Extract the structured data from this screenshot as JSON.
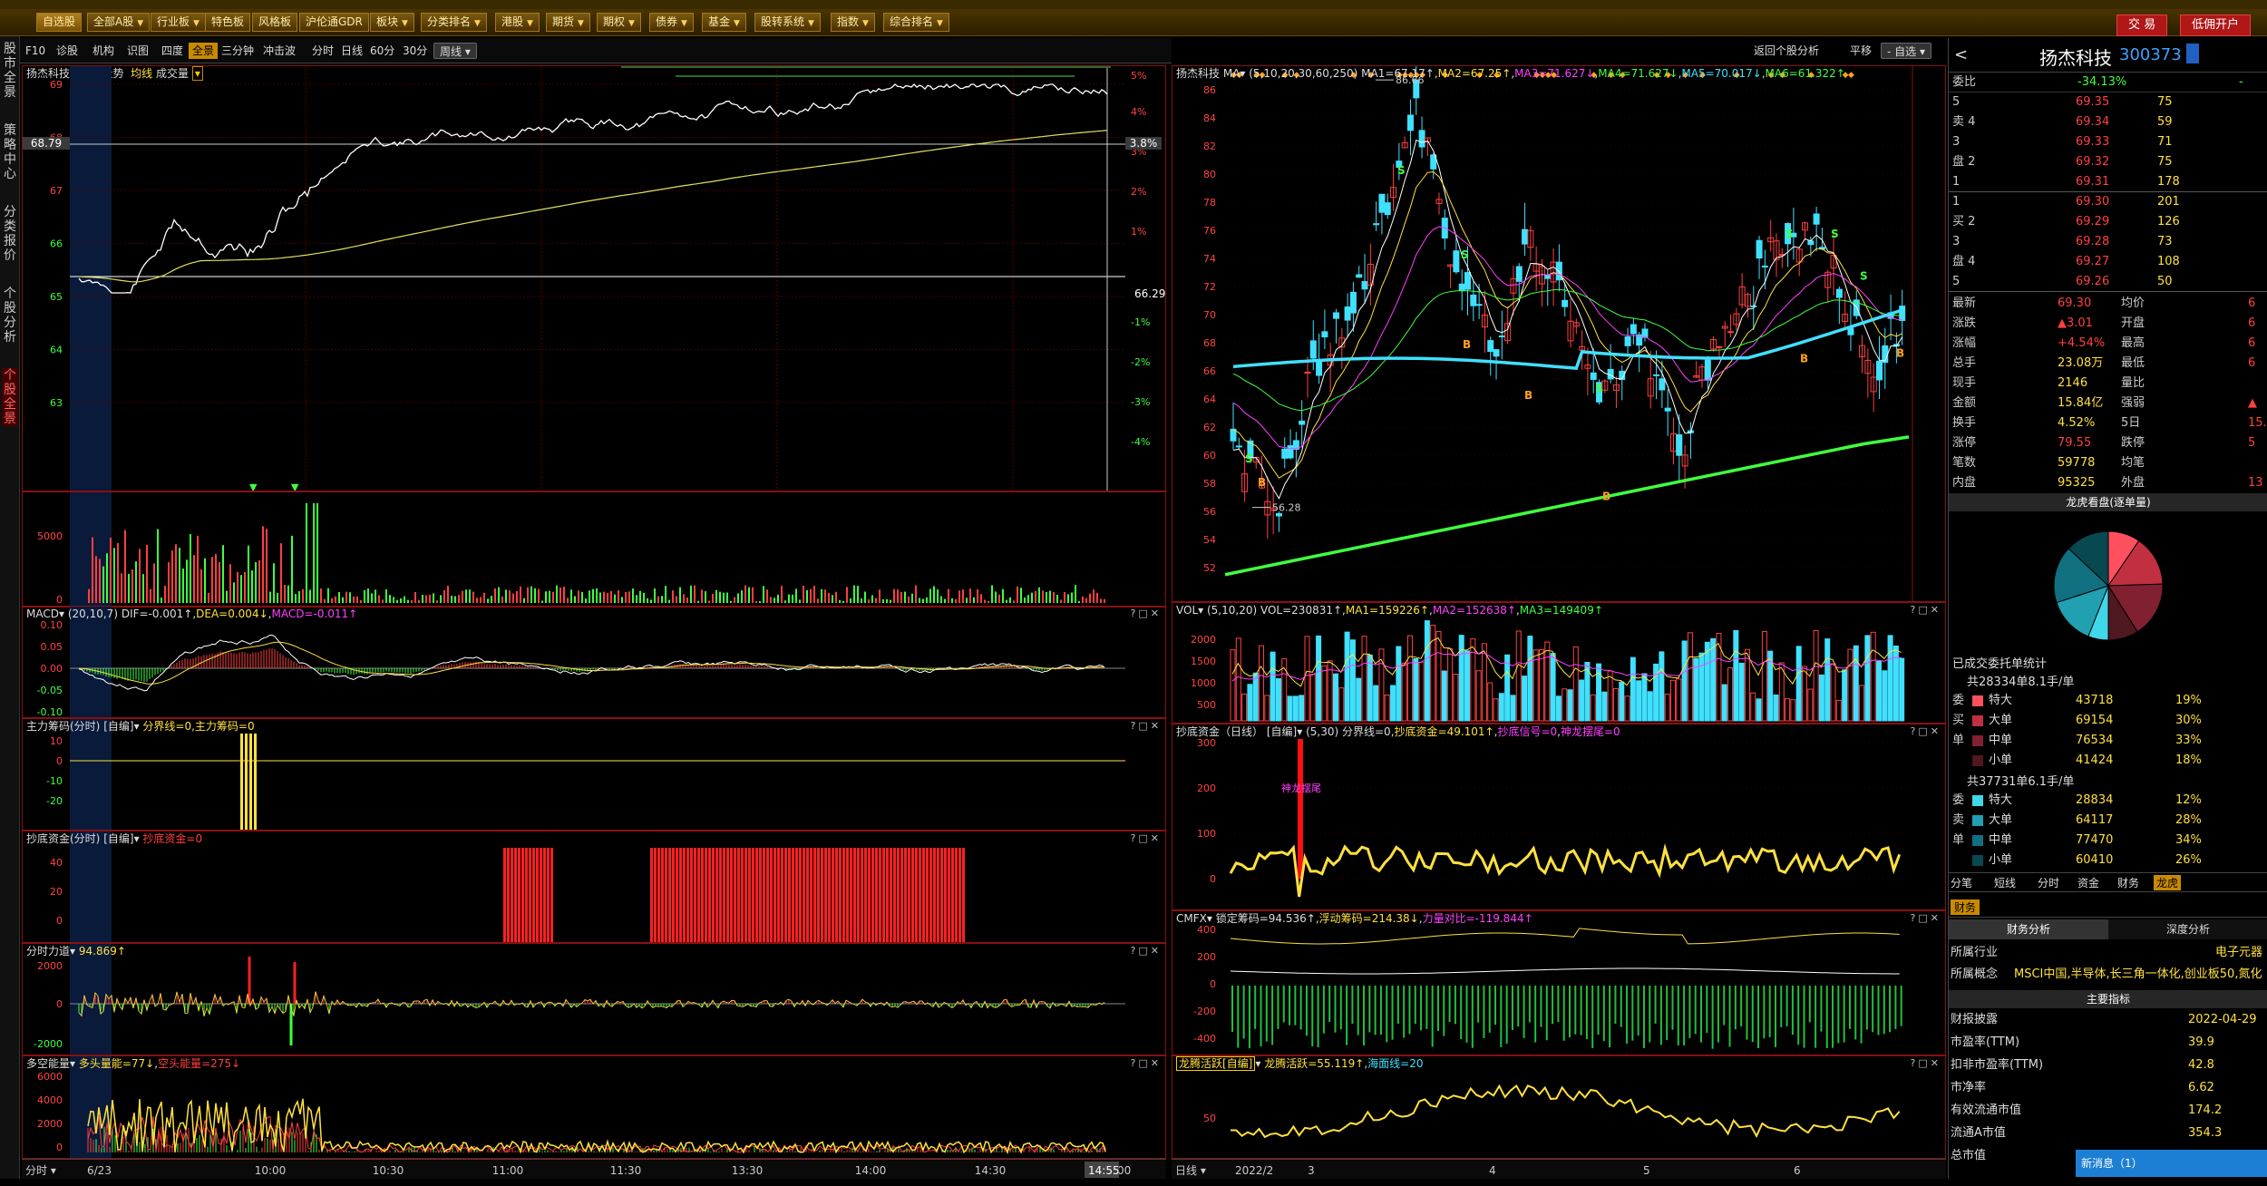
{
  "menubar": {
    "buttons": [
      "自选股",
      "全部A股",
      "行业板",
      "特色板",
      "风格板",
      "沪伦通GDR",
      "板块",
      "分类排名",
      "港股",
      "期货",
      "期权",
      "债券",
      "基金",
      "股转系统",
      "指数",
      "综合排名"
    ],
    "right_buttons": [
      "交 易",
      "低佣开户"
    ]
  },
  "lefttabs": [
    "股市全景",
    "策略中心",
    "分类报价",
    "个股分析",
    "个股全景"
  ],
  "toolbar": {
    "items": [
      "F10",
      "诊股",
      "机构",
      "识图",
      "四度",
      "全景",
      "三分钟",
      "冲击波",
      "分时",
      "日线",
      "60分",
      "30分",
      "周线"
    ],
    "right": [
      "返回个股分析",
      "平移",
      "自选"
    ]
  },
  "intraday": {
    "stock_name": "扬杰科技",
    "title": "分时走势",
    "avg_label": "均线",
    "vol_label": "成交量",
    "price_axis": [
      "69",
      "68",
      "67",
      "66",
      "65",
      "64",
      "63"
    ],
    "pct_axis": [
      "5%",
      "4%",
      "3%",
      "2%",
      "1%",
      "",
      "-1%",
      "-2%",
      "-3%",
      "-4%"
    ],
    "prev_close": "66.29",
    "cursor_price": "68.79",
    "cursor_pct": "3.8%",
    "vol_axis": [
      "5000",
      "0"
    ],
    "macd_title": "MACD",
    "macd_params": "(20,10,7)",
    "macd_dif": "DIF=-0.001↑",
    "macd_dea": "DEA=0.004↓",
    "macd_val": "MACD=-0.011↑",
    "macd_axis": [
      "0.10",
      "0.05",
      "0.00",
      "-0.05",
      "-0.10"
    ],
    "main_title": "主力筹码(分时)",
    "main_tag": "[自编]",
    "main_val": "分界线=0,主力筹码=0",
    "main_axis": [
      "10",
      "0",
      "-10",
      "-20"
    ],
    "bottom_title": "抄底资金(分时)",
    "bottom_tag": "[自编]",
    "bottom_val": "抄底资金=0",
    "bottom_axis": [
      "40",
      "20",
      "0"
    ],
    "force_title": "分时力道",
    "force_val": "94.869↑",
    "force_axis": [
      "2000",
      "0",
      "-2000"
    ],
    "energy_title": "多空能量",
    "energy_a": "多头量能=77↓",
    "energy_b": "空头能量=275↓",
    "energy_axis": [
      "6000",
      "4000",
      "2000",
      "0"
    ],
    "time_axis": [
      "6/23",
      "10:00",
      "10:30",
      "11:00",
      "11:30",
      "13:30",
      "14:00",
      "14:30",
      "15:00"
    ],
    "bottom_left": "分时",
    "cursor_time": "14:55"
  },
  "daily": {
    "stock_name": "扬杰科技",
    "ma_label": "MA",
    "ma_params": "(5,10,20,30,60,250)",
    "ma1": "MA1=67.17↑",
    "ma2": "MA2=67.25↑",
    "ma3": "MA3=71.627↓",
    "ma4": "MA4=71.627↓",
    "ma5": "MA5=70.017↓",
    "ma6": "MA6=61.322↑",
    "price_axis": [
      "86",
      "84",
      "82",
      "80",
      "78",
      "76",
      "74",
      "72",
      "70",
      "68",
      "66",
      "64",
      "62",
      "60",
      "58",
      "56",
      "54",
      "52"
    ],
    "high_mark": "86.66",
    "low_mark": "56.28",
    "vol_title": "VOL",
    "vol_params": "(5,10,20)",
    "vol_val": "VOL=230831↑",
    "vol_ma1": "MA1=159226↑",
    "vol_ma2": "MA2=152638↑",
    "vol_ma3": "MA3=149409↑",
    "vol_axis": [
      "2000",
      "1500",
      "1000",
      "500"
    ],
    "cd_title": "抄底资金（日线）",
    "cd_tag": "[自编]",
    "cd_params": "(5,30)",
    "cd_a": "分界线=0",
    "cd_b": "抄底资金=49.101↑",
    "cd_c": "抄底信号=0",
    "cd_d": "神龙摆尾=0",
    "cd_axis": [
      "300",
      "200",
      "100",
      "0"
    ],
    "cd_mark": "神龙摆尾",
    "cmfx_title": "CMFX",
    "cmfx_a": "锁定筹码=94.536↑",
    "cmfx_b": "浮动筹码=214.38↓",
    "cmfx_c": "力量对比=-119.844↑",
    "cmfx_axis": [
      "400",
      "200",
      "0",
      "-200",
      "-400"
    ],
    "lt_title": "龙腾活跃[自编]",
    "lt_a": "龙腾活跃=55.119↑",
    "lt_b": "海面线=20",
    "lt_axis": [
      "50"
    ],
    "date_axis": [
      "2022/2",
      "3",
      "4",
      "5",
      "6"
    ],
    "bottom_left": "日线"
  },
  "quote": {
    "name": "扬杰科技",
    "code": "300373",
    "webi_label": "委比",
    "webi_value": "-34.13%",
    "webi_count": "-",
    "sell": [
      {
        "label": "5",
        "price": "69.35",
        "vol": "75"
      },
      {
        "label": "卖 4",
        "price": "69.34",
        "vol": "59"
      },
      {
        "label": "3",
        "price": "69.33",
        "vol": "71"
      },
      {
        "label": "盘 2",
        "price": "69.32",
        "vol": "75"
      },
      {
        "label": "1",
        "price": "69.31",
        "vol": "178"
      }
    ],
    "buy": [
      {
        "label": "1",
        "price": "69.30",
        "vol": "201"
      },
      {
        "label": "买 2",
        "price": "69.29",
        "vol": "126"
      },
      {
        "label": "3",
        "price": "69.28",
        "vol": "73"
      },
      {
        "label": "盘 4",
        "price": "69.27",
        "vol": "108"
      },
      {
        "label": "5",
        "price": "69.26",
        "vol": "50"
      }
    ],
    "stats": [
      {
        "l": "最新",
        "v": "69.30",
        "l2": "均价",
        "v2": "6"
      },
      {
        "l": "涨跌",
        "v": "▲3.01",
        "l2": "开盘",
        "v2": "6"
      },
      {
        "l": "涨幅",
        "v": "+4.54%",
        "l2": "最高",
        "v2": "6"
      },
      {
        "l": "总手",
        "v": "23.08万",
        "l2": "最低",
        "v2": "6"
      },
      {
        "l": "现手",
        "v": "2146",
        "l2": "量比",
        "v2": ""
      },
      {
        "l": "金额",
        "v": "15.84亿",
        "l2": "强弱",
        "v2": "▲"
      },
      {
        "l": "换手",
        "v": "4.52%",
        "l2": "5日",
        "v2": "15."
      },
      {
        "l": "涨停",
        "v": "79.55",
        "l2": "跌停",
        "v2": "5"
      },
      {
        "l": "笔数",
        "v": "59778",
        "l2": "均笔",
        "v2": ""
      },
      {
        "l": "内盘",
        "v": "95325",
        "l2": "外盘",
        "v2": "13"
      }
    ],
    "pie_title": "龙虎看盘(逐单量)",
    "entrust_title": "已成交委托单统计",
    "buy_summary": "共28334单8.1手/单",
    "buy_rows": [
      {
        "side": "委",
        "type": "特大",
        "qty": "43718",
        "pct": "19%"
      },
      {
        "side": "买",
        "type": "大单",
        "qty": "69154",
        "pct": "30%"
      },
      {
        "side": "单",
        "type": "中单",
        "qty": "76534",
        "pct": "33%"
      },
      {
        "side": "",
        "type": "小单",
        "qty": "41424",
        "pct": "18%"
      }
    ],
    "sell_summary": "共37731单6.1手/单",
    "sell_rows": [
      {
        "side": "委",
        "type": "特大",
        "qty": "28834",
        "pct": "12%"
      },
      {
        "side": "卖",
        "type": "大单",
        "qty": "64117",
        "pct": "28%"
      },
      {
        "side": "单",
        "type": "中单",
        "qty": "77470",
        "pct": "34%"
      },
      {
        "side": "",
        "type": "小单",
        "qty": "60410",
        "pct": "26%"
      }
    ],
    "tabs": [
      "分笔",
      "短线",
      "分时",
      "资金",
      "财务",
      "龙虎"
    ],
    "fin_tab": "财务",
    "fin_sub": [
      "财务分析",
      "深度分析"
    ],
    "industry_label": "所属行业",
    "industry_val": "电子元器",
    "concept_label": "所属概念",
    "concept_val": "MSCI中国,半导体,长三角一体化,创业板50,氮化",
    "main_idx": "主要指标",
    "fin_rows": [
      {
        "l": "财报披露",
        "v": "2022-04-29"
      },
      {
        "l": "市盈率(TTM)",
        "v": "39.9"
      },
      {
        "l": "扣非市盈率(TTM)",
        "v": "42.8"
      },
      {
        "l": "市净率",
        "v": "6.62"
      },
      {
        "l": "有效流通市值",
        "v": "174.2"
      },
      {
        "l": "流通A市值",
        "v": "354.3"
      },
      {
        "l": "总市值",
        "v": ""
      }
    ],
    "newmsg": "新消息（1）"
  },
  "colors": {
    "red": "#ff4040",
    "green": "#40ff40",
    "yellow": "#ffe040",
    "cyan": "#40e0ff",
    "magenta": "#ff40ff",
    "border": "#8a1010"
  }
}
